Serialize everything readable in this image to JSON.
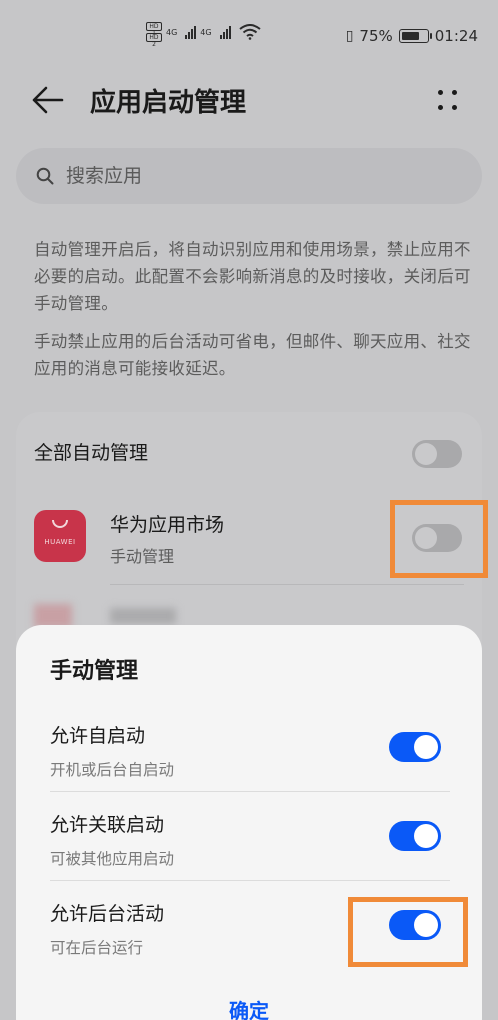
{
  "status_bar": {
    "hd_top": "HD 1",
    "hd_bottom": "HD 2",
    "net1": "4G",
    "net2": "4G",
    "battery_percent_text": "75%",
    "battery_level": 0.75,
    "time": "01:24"
  },
  "header": {
    "title": "应用启动管理",
    "back_icon": "arrow-left",
    "more_icon": "more-dots"
  },
  "search": {
    "placeholder": "搜索应用"
  },
  "descriptions": [
    "自动管理开启后，将自动识别应用和使用场景，禁止应用不必要的启动。此配置不会影响新消息的及时接收，关闭后可手动管理。",
    "手动禁止应用的后台活动可省电，但邮件、聊天应用、社交应用的消息可能接收延迟。"
  ],
  "app_list": {
    "all_auto_label": "全部自动管理",
    "all_auto_enabled": false,
    "apps": [
      {
        "name": "华为应用市场",
        "status": "手动管理",
        "icon_text": "HUAWEI",
        "enabled": false
      }
    ]
  },
  "sheet": {
    "title": "手动管理",
    "options": [
      {
        "label": "允许自启动",
        "sub": "开机或后台自启动",
        "enabled": true
      },
      {
        "label": "允许关联启动",
        "sub": "可被其他应用启动",
        "enabled": true
      },
      {
        "label": "允许后台活动",
        "sub": "可在后台运行",
        "enabled": true
      }
    ],
    "confirm_label": "确定"
  },
  "colors": {
    "accent": "#0a59f7",
    "highlight": "#f08a38",
    "app_icon": "#c8344a"
  }
}
